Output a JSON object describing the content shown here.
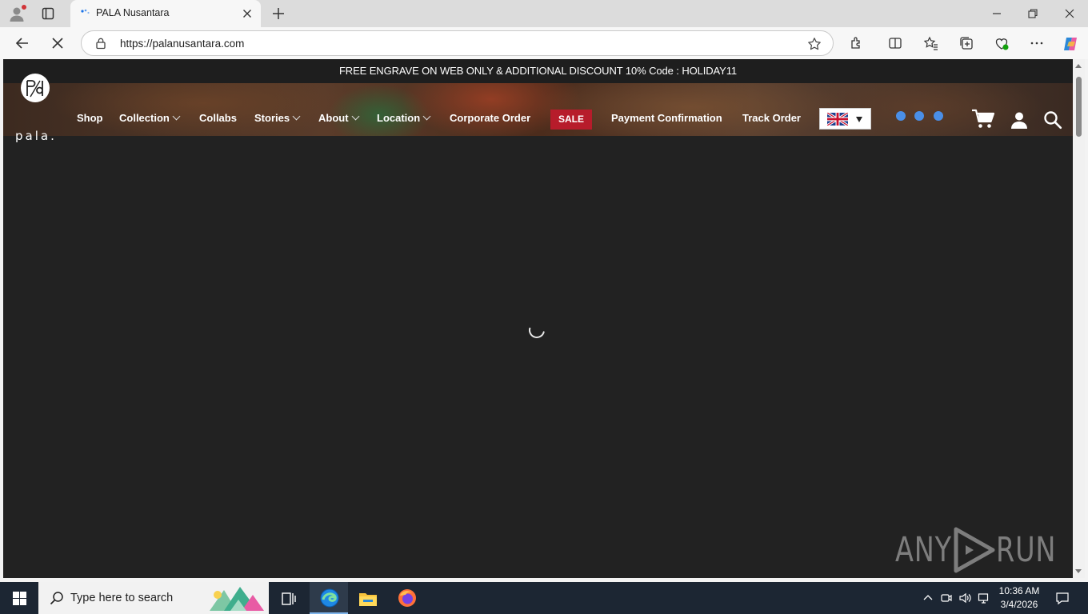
{
  "browser": {
    "tab_title": "PALA Nusantara",
    "url": "https://palanusantara.com"
  },
  "site": {
    "promo": "FREE ENGRAVE ON WEB ONLY & ADDITIONAL DISCOUNT 10% Code : HOLIDAY11",
    "logo_text": "pala.",
    "menu": {
      "shop": "Shop",
      "collection": "Collection",
      "collabs": "Collabs",
      "stories": "Stories",
      "about": "About",
      "location": "Location",
      "corporate": "Corporate Order",
      "sale": "SALE",
      "payment": "Payment Confirmation",
      "track": "Track Order"
    },
    "language": "uk-flag-icon",
    "colors": {
      "sale": "#b71c2b",
      "dots": "#4a8fe8",
      "page_bg": "#222222"
    }
  },
  "watermark": {
    "left": "ANY",
    "right": "RUN"
  },
  "taskbar": {
    "search_placeholder": "Type here to search",
    "time": "10:36 AM",
    "date": "3/4/2026"
  }
}
